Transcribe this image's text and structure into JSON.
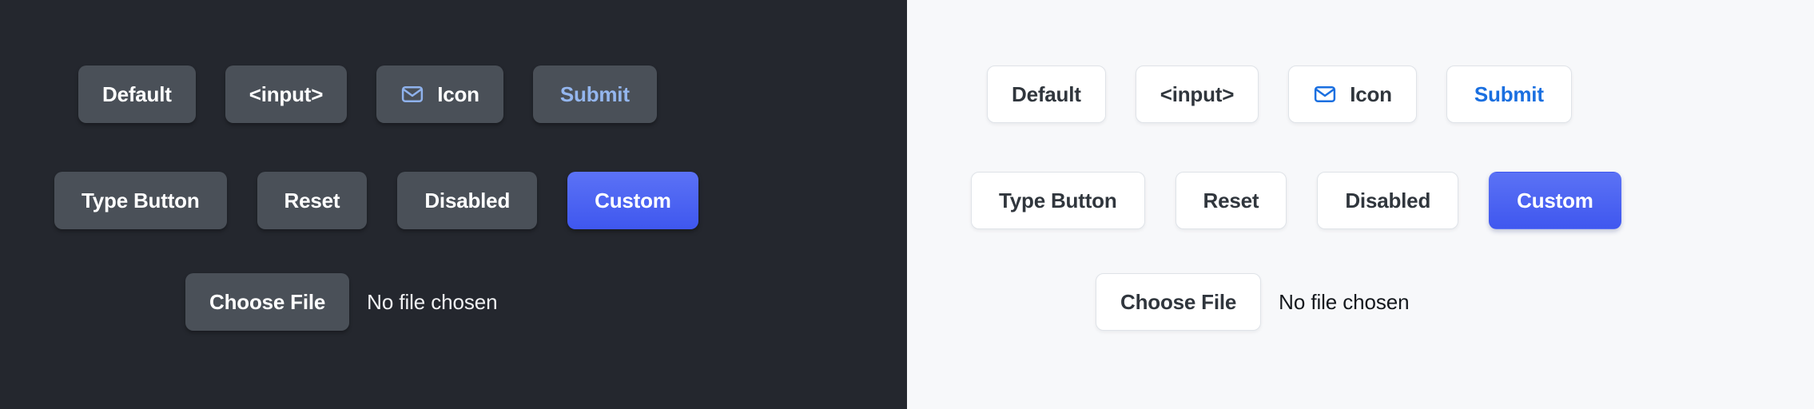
{
  "panels": [
    {
      "theme": "dark",
      "background": "#24272E",
      "button_fill": "#4A5058",
      "accent": "#94B6EE",
      "primary": "#4257F0",
      "rows": [
        {
          "buttons": [
            {
              "label": "Default",
              "variant": "default",
              "icon": null
            },
            {
              "label": "<input>",
              "variant": "default",
              "icon": null
            },
            {
              "label": "Icon",
              "variant": "default",
              "icon": "envelope-icon"
            },
            {
              "label": "Submit",
              "variant": "accent-text",
              "icon": null
            }
          ]
        },
        {
          "buttons": [
            {
              "label": "Type Button",
              "variant": "default",
              "icon": null
            },
            {
              "label": "Reset",
              "variant": "default",
              "icon": null
            },
            {
              "label": "Disabled",
              "variant": "default",
              "icon": null
            },
            {
              "label": "Custom",
              "variant": "primary",
              "icon": null
            }
          ]
        }
      ],
      "file_input": {
        "button_label": "Choose File",
        "file_status": "No file chosen"
      }
    },
    {
      "theme": "light",
      "background": "#F7F8FA",
      "button_fill": "#FFFFFF",
      "button_border": "#DFE3E8",
      "accent": "#1A6FE0",
      "primary": "#4257F0",
      "rows": [
        {
          "buttons": [
            {
              "label": "Default",
              "variant": "default",
              "icon": null
            },
            {
              "label": "<input>",
              "variant": "default",
              "icon": null
            },
            {
              "label": "Icon",
              "variant": "default",
              "icon": "envelope-icon"
            },
            {
              "label": "Submit",
              "variant": "accent-text",
              "icon": null
            }
          ]
        },
        {
          "buttons": [
            {
              "label": "Type Button",
              "variant": "default",
              "icon": null
            },
            {
              "label": "Reset",
              "variant": "default",
              "icon": null
            },
            {
              "label": "Disabled",
              "variant": "default",
              "icon": null
            },
            {
              "label": "Custom",
              "variant": "primary",
              "icon": null
            }
          ]
        }
      ],
      "file_input": {
        "button_label": "Choose File",
        "file_status": "No file chosen"
      }
    }
  ]
}
